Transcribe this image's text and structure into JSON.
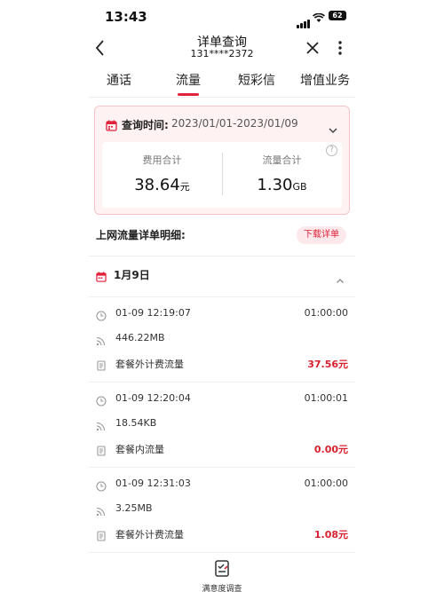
{
  "status_bar": {
    "time": "13:43",
    "battery": "62"
  },
  "nav": {
    "title": "详单查询",
    "subtitle": "131****2372"
  },
  "tabs": [
    {
      "label": "通话"
    },
    {
      "label": "流量"
    },
    {
      "label": "短彩信"
    },
    {
      "label": "增值业务"
    }
  ],
  "summary": {
    "query_label": "查询时间:",
    "query_range": "2023/01/01-2023/01/09",
    "fee_label": "费用合计",
    "fee_value": "38.64",
    "fee_unit": "元",
    "traffic_label": "流量合计",
    "traffic_value": "1.30",
    "traffic_unit": "GB",
    "help": "?"
  },
  "detail": {
    "title": "上网流量详单明细:",
    "download_label": "下载详单"
  },
  "group": {
    "date": "1月9日"
  },
  "records": [
    {
      "time": "01-09 12:19:07",
      "duration": "01:00:00",
      "amount": "446.22MB",
      "type": "套餐外计费流量",
      "fee": "37.56元"
    },
    {
      "time": "01-09 12:20:04",
      "duration": "01:00:01",
      "amount": "18.54KB",
      "type": "套餐内流量",
      "fee": "0.00元"
    },
    {
      "time": "01-09 12:31:03",
      "duration": "01:00:00",
      "amount": "3.25MB",
      "type": "套餐外计费流量",
      "fee": "1.08元"
    }
  ],
  "footer": {
    "survey_label": "满意度调查"
  },
  "colors": {
    "accent": "#e0223a",
    "card_bg": "#fff2f3",
    "fee_red": "#d8202f"
  }
}
